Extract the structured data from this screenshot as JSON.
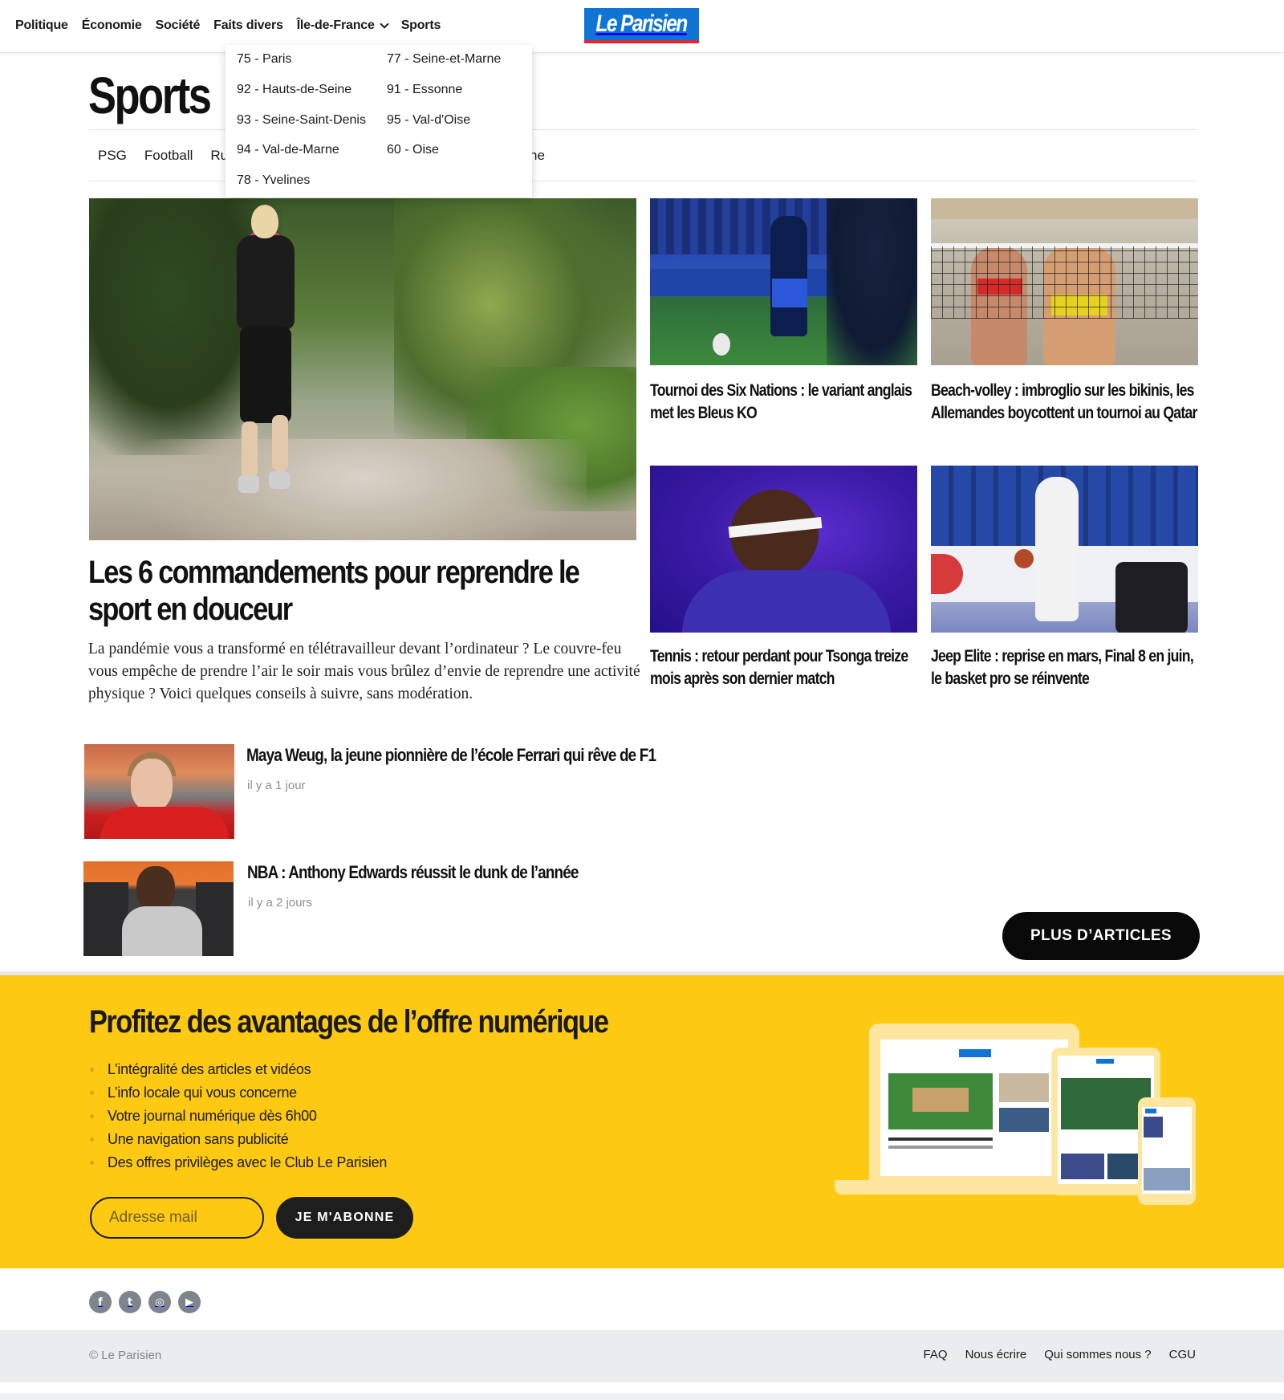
{
  "nav": {
    "items": [
      {
        "label": "Politique"
      },
      {
        "label": "Économie"
      },
      {
        "label": "Société"
      },
      {
        "label": "Faits divers"
      },
      {
        "label": "Île-de-France"
      },
      {
        "label": "Sports"
      }
    ],
    "logo_text": "Le Parisien"
  },
  "dropdown": {
    "items": [
      "75 - Paris",
      "77 - Seine-et-Marne",
      "92 - Hauts-de-Seine",
      "91 - Essonne",
      "93 - Seine-Saint-Denis",
      "95 - Val-d'Oise",
      "94 - Val-de-Marne",
      "60 - Oise",
      "78 - Yvelines"
    ]
  },
  "section": {
    "title": "Sports",
    "subnav": [
      "PSG",
      "Football",
      "Rug"
    ],
    "subnav_tail": "ne"
  },
  "main_article": {
    "title": "Les 6 commandements pour reprendre le sport en douceur",
    "description": "La pandémie vous a transformé en télétravailleur devant l’ordinateur ? Le couvre-feu vous empêche de prendre l’air le soir mais vous brûlez d’envie de reprendre une activité physique ? Voici quelques conseils à suivre, sans modération."
  },
  "cards": [
    {
      "title": "Tournoi des Six Nations : le variant anglais met les Bleus KO"
    },
    {
      "title": "Beach-volley : imbroglio sur les bikinis, les Allemandes boycottent un tournoi au Qatar"
    },
    {
      "title": "Tennis : retour perdant pour Tsonga treize mois après son dernier match"
    },
    {
      "title": "Jeep Elite : reprise en mars, Final 8 en juin, le basket pro se réinvente"
    }
  ],
  "list": [
    {
      "title": "Maya Weug, la jeune pionnière de l’école Ferrari qui rêve de F1",
      "time": "il y a 1 jour"
    },
    {
      "title": "NBA : Anthony Edwards réussit le dunk de l’année",
      "time": "il y a 2 jours"
    }
  ],
  "more_button": "PLUS D’ARTICLES",
  "promo": {
    "title": "Profitez des avantages de l’offre numérique",
    "benefits": [
      "L’intégralité des articles et vidéos",
      "L’info locale qui vous concerne",
      "Votre journal numérique dès 6h00",
      "Une navigation sans publicité",
      "Des offres privilèges avec le Club Le Parisien"
    ],
    "email_placeholder": "Adresse mail",
    "subscribe_label": "JE M'ABONNE",
    "accent_color": "#fdc912"
  },
  "social": {
    "icons": [
      "facebook-icon",
      "twitter-icon",
      "instagram-icon",
      "youtube-icon"
    ]
  },
  "footer": {
    "copyright": "© Le Parisien",
    "links": [
      "FAQ",
      "Nous écrire",
      "Qui sommes nous ?",
      "CGU"
    ]
  },
  "colors": {
    "brand_blue": "#1074d4",
    "brand_red": "#e3262f",
    "button_black": "#0a0a0a"
  }
}
